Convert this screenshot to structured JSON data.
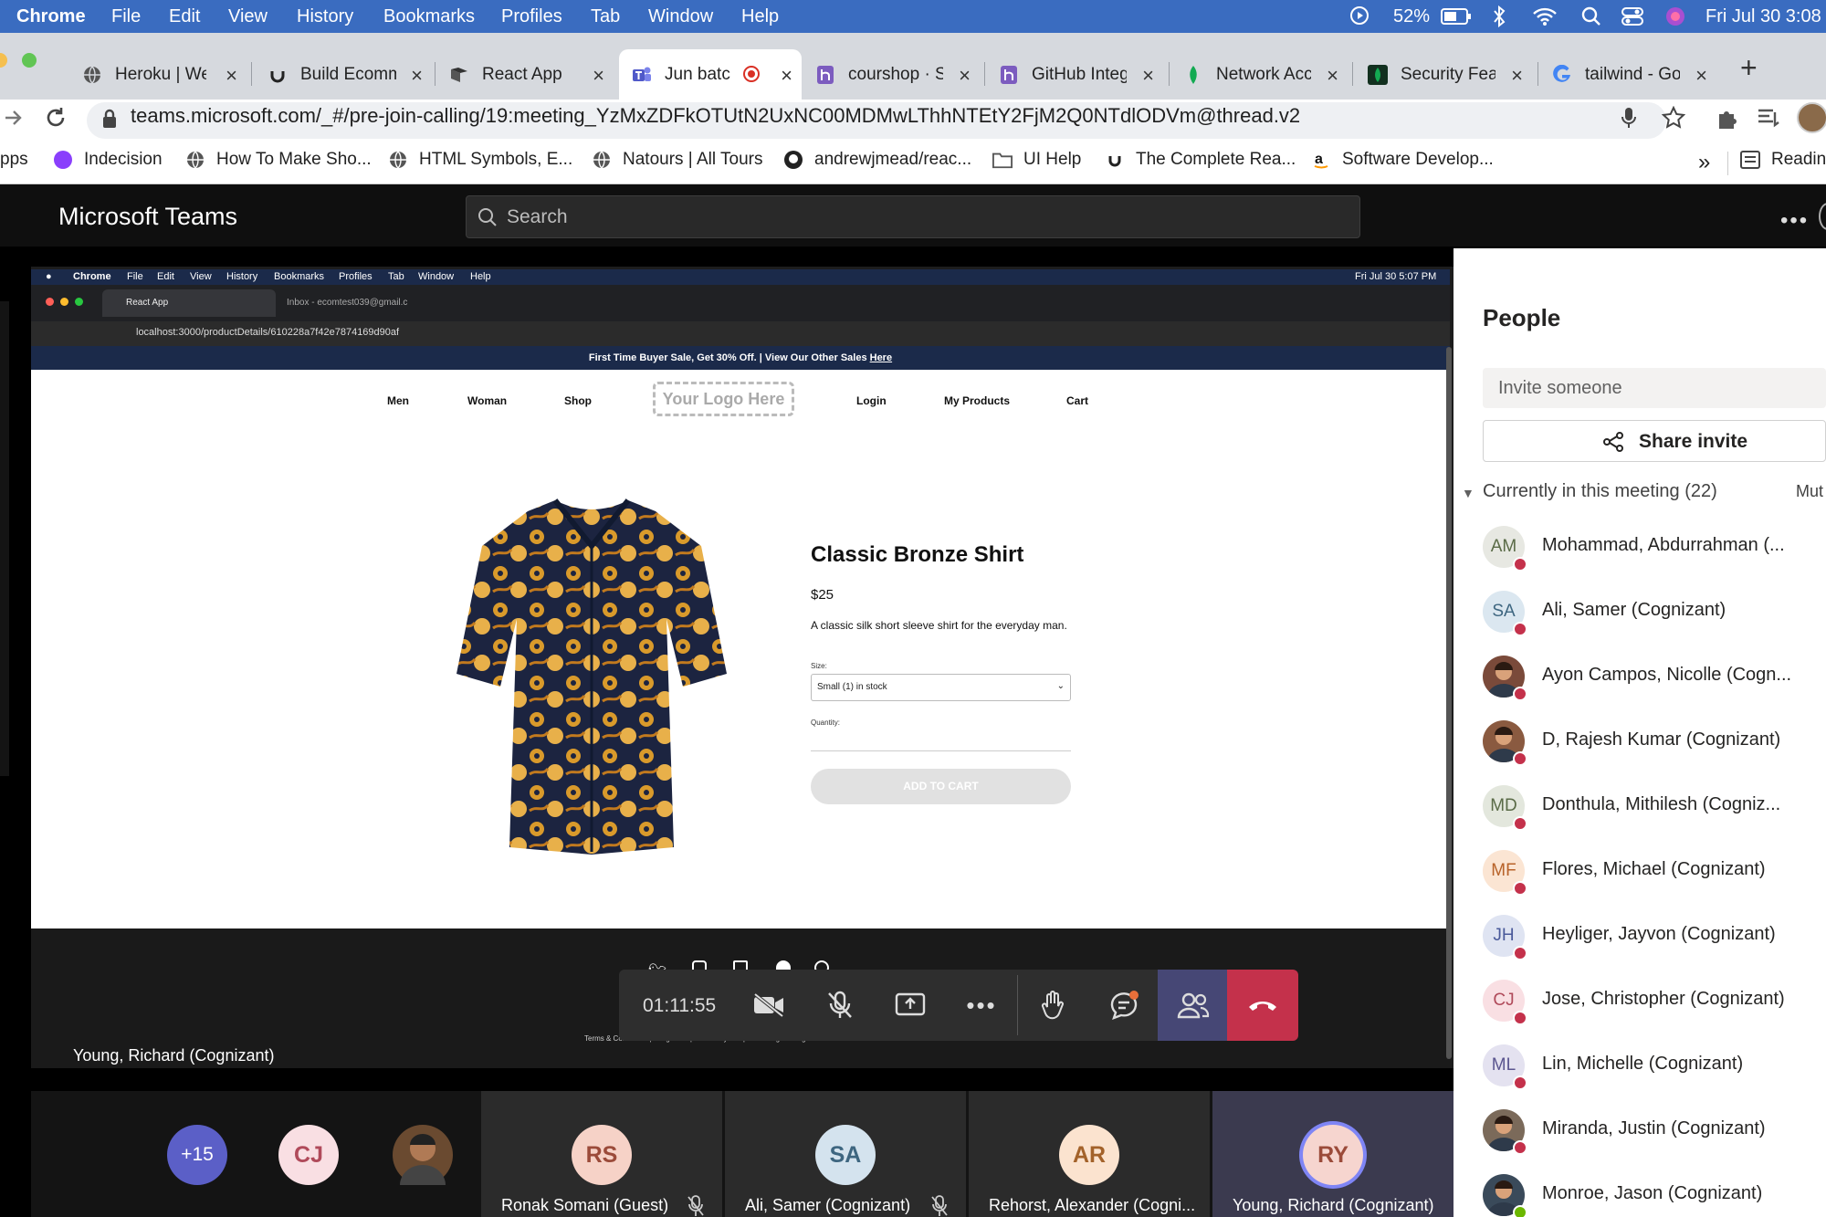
{
  "mac_menu": {
    "items": [
      "Chrome",
      "File",
      "Edit",
      "View",
      "History",
      "Bookmarks",
      "Profiles",
      "Tab",
      "Window",
      "Help"
    ],
    "battery": "52%",
    "clock": "Fri Jul 30  3:08"
  },
  "browser": {
    "tabs": [
      {
        "title": "Heroku | Wel"
      },
      {
        "title": "Build Ecomm"
      },
      {
        "title": "React App"
      },
      {
        "title": "Jun batc"
      },
      {
        "title": "courshop · S"
      },
      {
        "title": "GitHub Integ"
      },
      {
        "title": "Network Acc"
      },
      {
        "title": "Security Fea"
      },
      {
        "title": "tailwind - Go"
      }
    ],
    "url": "teams.microsoft.com/_#/pre-join-calling/19:meeting_YzMxZDFkOTUtN2UxNC00MDMwLThhNTEtY2FjM2Q0NTdlODVm@thread.v2",
    "bookmarks": [
      "pps",
      "Indecision",
      "How To Make Sho...",
      "HTML Symbols, E...",
      "Natours | All Tours",
      "andrewjmead/reac...",
      "UI Help",
      "The Complete Rea...",
      "Software Develop..."
    ],
    "reading_list": "Readin"
  },
  "teams": {
    "title": "Microsoft Teams",
    "search_placeholder": "Search"
  },
  "shared": {
    "inner_menu": [
      "Chrome",
      "File",
      "Edit",
      "View",
      "History",
      "Bookmarks",
      "Profiles",
      "Tab",
      "Window",
      "Help"
    ],
    "inner_clock": "Fri Jul 30  5:07 PM",
    "inner_tab1": "React App",
    "inner_tab2": "Inbox - ecomtest039@gmail.c",
    "inner_url": "localhost:3000/productDetails/610228a7f42e7874169d90af",
    "promo": "First Time Buyer Sale, Get 30% Off. | View Our Other Sales",
    "promo_link": "Here",
    "nav": [
      "Men",
      "Woman",
      "Shop",
      "Login",
      "My Products",
      "Cart"
    ],
    "logo": "Your Logo Here",
    "product": {
      "title": "Classic Bronze Shirt",
      "price": "$25",
      "description": "A classic silk short sleeve shirt for the everyday man.",
      "size_label": "Size:",
      "size_value": "Small (1) in stock",
      "quantity_label": "Quantity:",
      "add_to_cart": "ADD TO CART"
    },
    "footer_terms": "Terms & Conditions | Integration | © 2021 by Template Design. All rights reserved.",
    "presenter": "Young, Richard (Cognizant)"
  },
  "call": {
    "timer": "01:11:55"
  },
  "people_panel": {
    "title": "People",
    "invite_placeholder": "Invite someone",
    "share_invite": "Share invite",
    "current_label": "Currently in this meeting (22)",
    "mute_all": "Mut",
    "participants": [
      {
        "initials": "AM",
        "name": "Mohammad, Abdurrahman (...",
        "bg": "#e7e8e2",
        "fg": "#5a6b47",
        "photo": false
      },
      {
        "initials": "SA",
        "name": "Ali, Samer (Cognizant)",
        "bg": "#dbe7f0",
        "fg": "#3e6680",
        "photo": false
      },
      {
        "initials": "",
        "name": "Ayon Campos, Nicolle (Cogn...",
        "bg": "#7a4a3a",
        "fg": "#fff",
        "photo": true
      },
      {
        "initials": "",
        "name": "D, Rajesh Kumar (Cognizant)",
        "bg": "#8a5a40",
        "fg": "#fff",
        "photo": true
      },
      {
        "initials": "MD",
        "name": "Donthula, Mithilesh (Cogniz...",
        "bg": "#e3e7dd",
        "fg": "#5a6b47",
        "photo": false
      },
      {
        "initials": "MF",
        "name": "Flores, Michael (Cognizant)",
        "bg": "#fbe5d3",
        "fg": "#b8632a",
        "photo": false
      },
      {
        "initials": "JH",
        "name": "Heyliger, Jayvon (Cognizant)",
        "bg": "#dfe4f2",
        "fg": "#4a5a9a",
        "photo": false
      },
      {
        "initials": "CJ",
        "name": "Jose, Christopher (Cognizant)",
        "bg": "#f9dfe3",
        "fg": "#b04a5a",
        "photo": false
      },
      {
        "initials": "ML",
        "name": "Lin, Michelle (Cognizant)",
        "bg": "#e4e2f0",
        "fg": "#5b5690",
        "photo": false
      },
      {
        "initials": "",
        "name": "Miranda, Justin (Cognizant)",
        "bg": "#7b6a5a",
        "fg": "#fff",
        "photo": true
      },
      {
        "initials": "",
        "name": "Monroe, Jason (Cognizant)",
        "bg": "#3a4a5a",
        "fg": "#fff",
        "photo": true,
        "green": true
      }
    ]
  },
  "strip": {
    "overflow": "+15",
    "cj": "CJ",
    "tiles": [
      {
        "initials": "RS",
        "name": "Ronak Somani (Guest)",
        "bg": "#f6d2c7",
        "fg": "#9b4b3a"
      },
      {
        "initials": "SA",
        "name": "Ali, Samer (Cognizant)",
        "bg": "#d4e3ee",
        "fg": "#3e6680"
      },
      {
        "initials": "AR",
        "name": "Rehorst, Alexander (Cogni...",
        "bg": "#fbe3cf",
        "fg": "#a3622a"
      },
      {
        "initials": "RY",
        "name": "Young, Richard (Cognizant)",
        "bg": "#f6d5cf",
        "fg": "#9b4b3a"
      }
    ]
  },
  "colors": {
    "teams_accent": "#6264a7",
    "hangup": "#c4314b",
    "mac_menu_bg": "#3a6cc0"
  }
}
